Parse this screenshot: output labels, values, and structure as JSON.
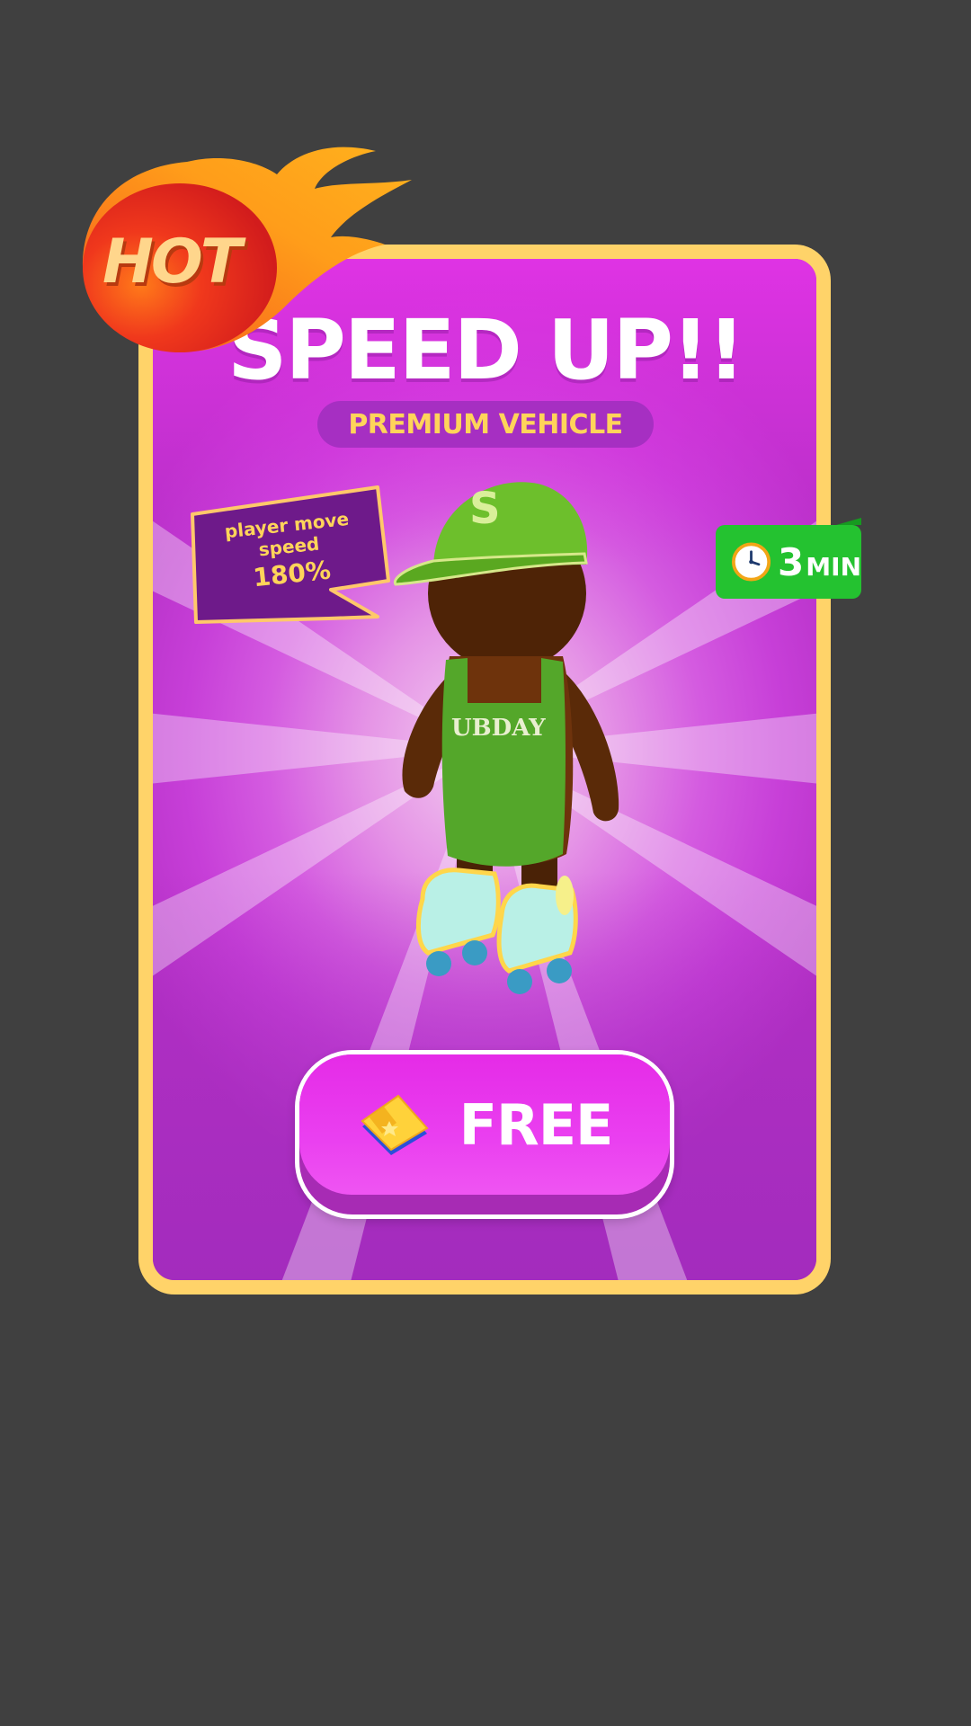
{
  "offer": {
    "title": "SPEED UP!!",
    "subtitle": "PREMIUM VEHICLE",
    "badge": "HOT",
    "bubble_line1": "player move speed",
    "bubble_line2": "180%",
    "timer_value": "3",
    "timer_unit": "MIN",
    "timer_icon": "clock-icon",
    "shirt_text": "UBDAY",
    "cap_letter": "S",
    "button_label": "FREE",
    "button_icon": "ticket-icon"
  },
  "colors": {
    "background": "#404040",
    "card_border": "#ffd369",
    "card_primary": "#d740e0",
    "accent_yellow": "#ffd45a",
    "timer_green": "#24c230",
    "button_magenta": "#e52be7"
  }
}
